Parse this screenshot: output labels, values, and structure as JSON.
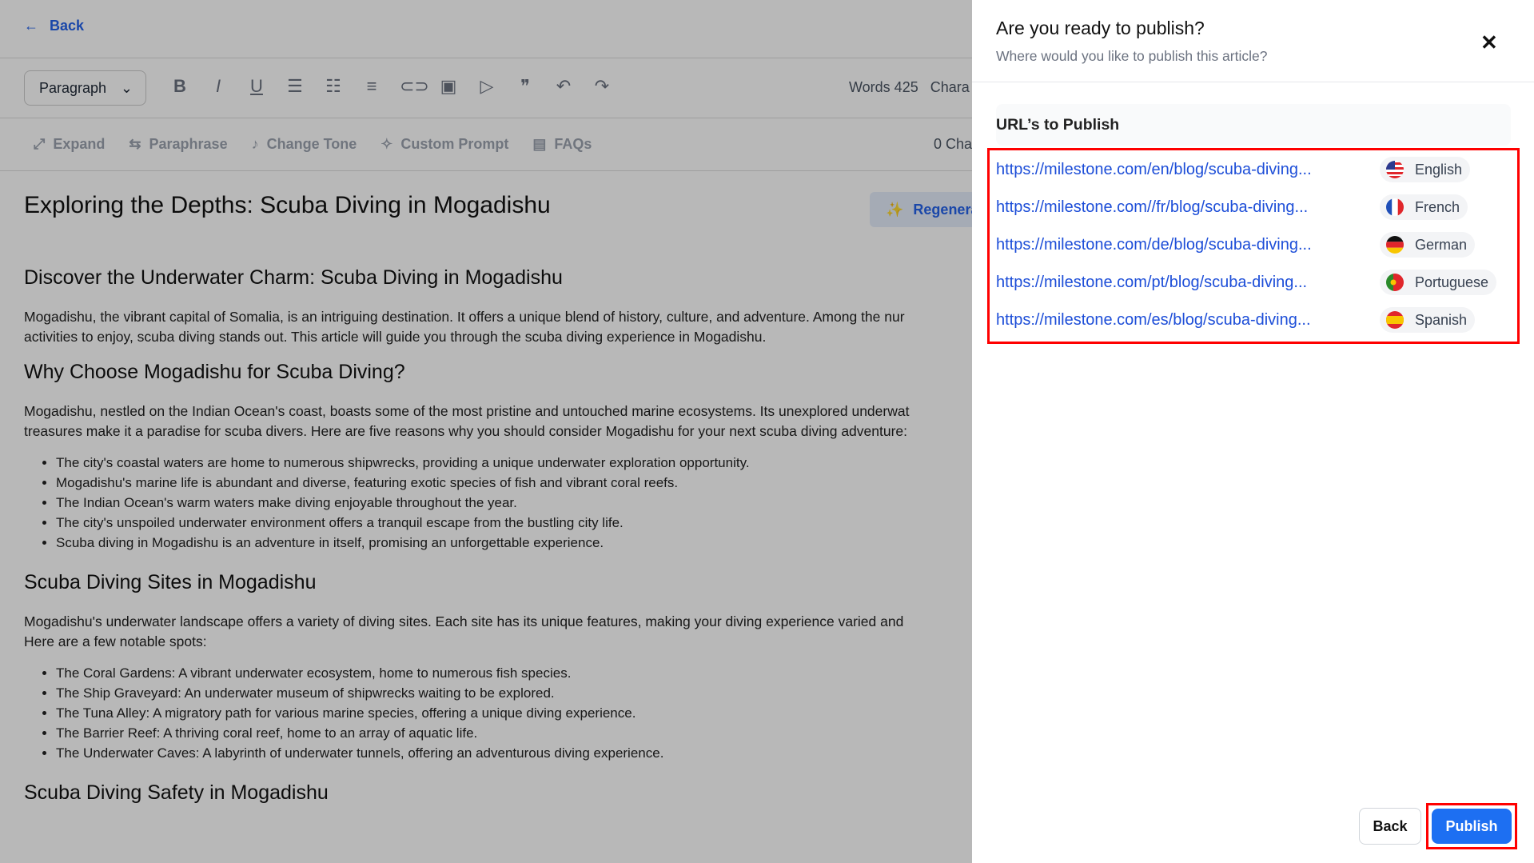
{
  "editor": {
    "back_label": "Back",
    "block_format": "Paragraph",
    "words": "Words 425",
    "chars": "Chara",
    "ai_tools": [
      "Expand",
      "Paraphrase",
      "Change Tone",
      "Custom Prompt",
      "FAQs"
    ],
    "ai_chars": "0 Cha",
    "regenerate": "Regenera",
    "article": {
      "title": "Exploring the Depths: Scuba Diving in Mogadishu",
      "h2_1": "Discover the Underwater Charm: Scuba Diving in Mogadishu",
      "p1": "Mogadishu, the vibrant capital of Somalia, is an intriguing destination. It offers a unique blend of history, culture, and adventure. Among the nur",
      "p1b": "activities to enjoy, scuba diving stands out. This article will guide you through the scuba diving experience in Mogadishu.",
      "h2_2": "Why Choose Mogadishu for Scuba Diving?",
      "p2": "Mogadishu, nestled on the Indian Ocean's coast, boasts some of the most pristine and untouched marine ecosystems. Its unexplored underwat",
      "p2b": "treasures make it a paradise for scuba divers. Here are five reasons why you should consider Mogadishu for your next scuba diving adventure:",
      "list1": [
        "The city's coastal waters are home to numerous shipwrecks, providing a unique underwater exploration opportunity.",
        "Mogadishu's marine life is abundant and diverse, featuring exotic species of fish and vibrant coral reefs.",
        "The Indian Ocean's warm waters make diving enjoyable throughout the year.",
        "The city's unspoiled underwater environment offers a tranquil escape from the bustling city life.",
        "Scuba diving in Mogadishu is an adventure in itself, promising an unforgettable experience."
      ],
      "h2_3": "Scuba Diving Sites in Mogadishu",
      "p3": "Mogadishu's underwater landscape offers a variety of diving sites. Each site has its unique features, making your diving experience varied and",
      "p3b": "Here are a few notable spots:",
      "list2": [
        "The Coral Gardens: A vibrant underwater ecosystem, home to numerous fish species.",
        "The Ship Graveyard: An underwater museum of shipwrecks waiting to be explored.",
        "The Tuna Alley: A migratory path for various marine species, offering a unique diving experience.",
        "The Barrier Reef: A thriving coral reef, home to an array of aquatic life.",
        "The Underwater Caves: A labyrinth of underwater tunnels, offering an adventurous diving experience."
      ],
      "h2_4": "Scuba Diving Safety in Mogadishu"
    }
  },
  "modal": {
    "title": "Are you ready to publish?",
    "subtitle": "Where would you like to publish this article?",
    "urls_header": "URL’s to Publish",
    "urls": [
      {
        "url": "https://milestone.com/en/blog/scuba-diving...",
        "lang": "English",
        "flag": "us"
      },
      {
        "url": "https://milestone.com//fr/blog/scuba-diving...",
        "lang": "French",
        "flag": "fr"
      },
      {
        "url": "https://milestone.com/de/blog/scuba-diving...",
        "lang": "German",
        "flag": "de"
      },
      {
        "url": "https://milestone.com/pt/blog/scuba-diving...",
        "lang": "Portuguese",
        "flag": "pt"
      },
      {
        "url": "https://milestone.com/es/blog/scuba-diving...",
        "lang": "Spanish",
        "flag": "es"
      }
    ],
    "back_button": "Back",
    "publish_button": "Publish",
    "accent": "#1d6ff2",
    "highlight": "#ff0000"
  }
}
